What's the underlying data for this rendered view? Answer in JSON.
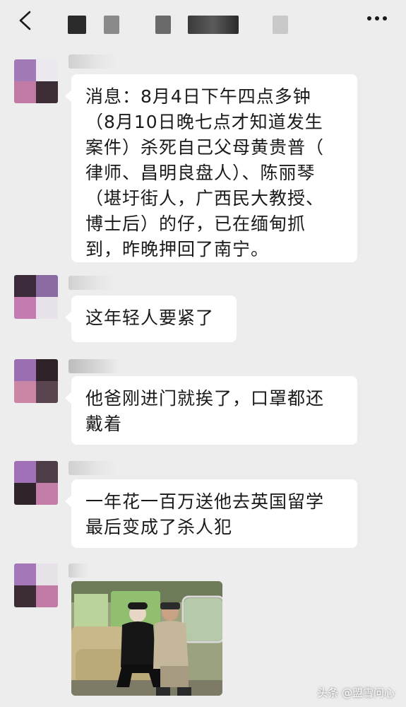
{
  "header": {
    "back_icon": "chevron-left-icon",
    "more_icon": "ellipsis-icon"
  },
  "messages": [
    {
      "lines": [
        "消息：8月4日下午四点多钟",
        "（8月10日晚七点才知道发生",
        "案件）杀死自己父母黄贵普（",
        "律师、昌明良盘人）、陈丽琴",
        "（堪圩街人，广西民大教授、",
        "博士后）的仔，已在缅甸抓",
        "到，昨晚押回了南宁。"
      ]
    },
    {
      "lines": [
        "这年轻人要紧了"
      ]
    },
    {
      "lines": [
        "他爸刚进门就挨了，口罩都还",
        "戴着"
      ]
    },
    {
      "lines": [
        "一年花一百万送他去英国留学",
        " 最后变成了杀人犯"
      ]
    }
  ],
  "watermark": "头条 @盟雪问心",
  "colors": {
    "background": "#ededed",
    "bubble": "#ffffff",
    "text": "#1a1a1a"
  }
}
